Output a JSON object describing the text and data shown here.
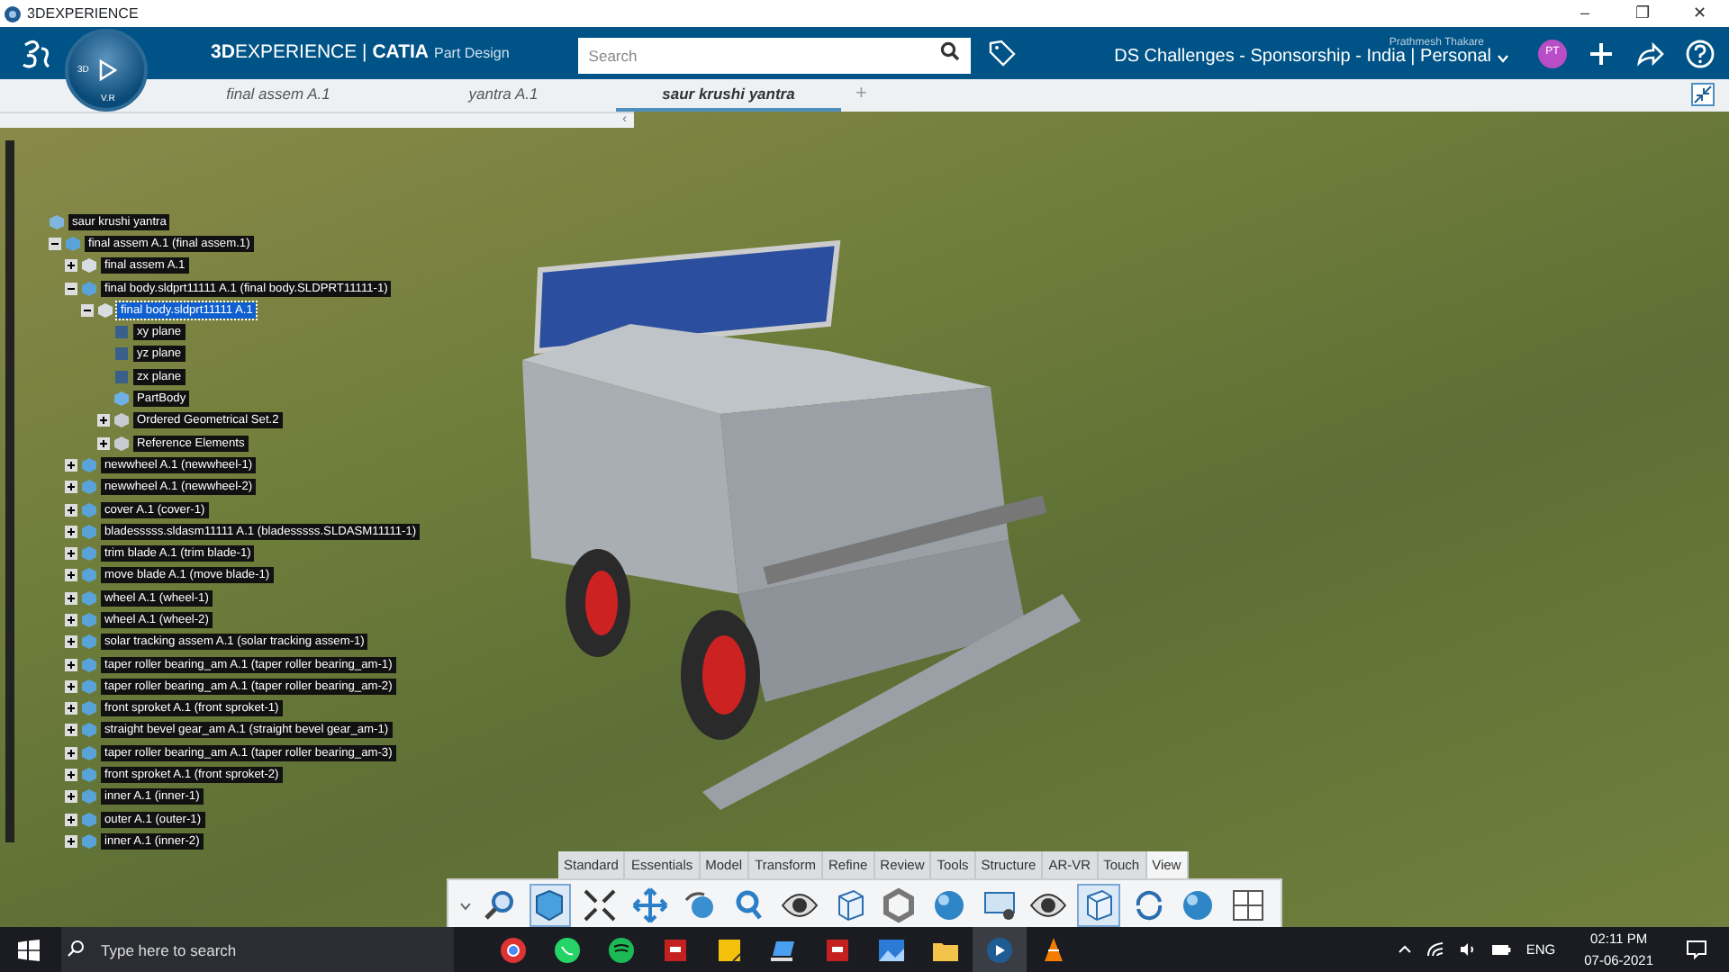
{
  "window": {
    "title": "3DEXPERIENCE",
    "controls": [
      "–",
      "❐",
      "✕"
    ]
  },
  "topbar": {
    "compass_labels": [
      "3D",
      "V.R"
    ],
    "brand": "**3D**EXPERIENCE | **CATIA**",
    "app": "Part Design",
    "search": {
      "placeholder": "Search"
    },
    "user": "Prathmesh Thakare",
    "context": "DS Challenges - Sponsorship - India | Personal",
    "avatar": "PT"
  },
  "tabs": [
    {
      "label": "final assem A.1",
      "selected": false
    },
    {
      "label": "yantra A.1",
      "selected": false
    },
    {
      "label": "saur krushi yantra",
      "selected": true
    }
  ],
  "tabs_add": "+",
  "panel_toggle": "‹",
  "tree": [
    {
      "label": "saur krushi yantra",
      "kind": "root",
      "selected": false,
      "children": [
        {
          "label": "final assem A.1 (final assem.1)",
          "kind": "product",
          "expanded": true,
          "selected": false,
          "children": [
            {
              "label": "final assem A.1",
              "kind": "part",
              "expanded": false,
              "selected": false
            },
            {
              "label": "final body.sldprt11111 A.1 (final body.SLDPRT11111-1)",
              "kind": "product",
              "expanded": true,
              "selected": false,
              "children": [
                {
                  "label": "final body.sldprt11111 A.1",
                  "kind": "part",
                  "expanded": true,
                  "selected": true,
                  "children": [
                    {
                      "label": "xy plane",
                      "kind": "plane",
                      "selected": false
                    },
                    {
                      "label": "yz plane",
                      "kind": "plane",
                      "selected": false
                    },
                    {
                      "label": "zx plane",
                      "kind": "plane",
                      "selected": false
                    },
                    {
                      "label": "PartBody",
                      "kind": "body",
                      "selected": false
                    },
                    {
                      "label": "Ordered Geometrical Set.2",
                      "kind": "set",
                      "expanded": false,
                      "selected": false
                    },
                    {
                      "label": "Reference Elements",
                      "kind": "set",
                      "expanded": false,
                      "selected": false
                    }
                  ]
                }
              ]
            },
            {
              "label": "newwheel A.1 (newwheel-1)",
              "kind": "product",
              "expanded": false,
              "selected": false
            },
            {
              "label": "newwheel A.1 (newwheel-2)",
              "kind": "product",
              "expanded": false,
              "selected": false
            },
            {
              "label": "cover A.1 (cover-1)",
              "kind": "product",
              "expanded": false,
              "selected": false
            },
            {
              "label": "bladesssss.sldasm11111 A.1 (bladesssss.SLDASM11111-1)",
              "kind": "product",
              "expanded": false,
              "selected": false
            },
            {
              "label": "trim blade A.1 (trim blade-1)",
              "kind": "product",
              "expanded": false,
              "selected": false
            },
            {
              "label": "move blade A.1 (move blade-1)",
              "kind": "product",
              "expanded": false,
              "selected": false
            },
            {
              "label": "wheel A.1 (wheel-1)",
              "kind": "product",
              "expanded": false,
              "selected": false
            },
            {
              "label": "wheel A.1 (wheel-2)",
              "kind": "product",
              "expanded": false,
              "selected": false
            },
            {
              "label": "solar tracking assem A.1 (solar tracking assem-1)",
              "kind": "product",
              "expanded": false,
              "selected": false
            },
            {
              "label": "taper roller bearing_am A.1 (taper roller bearing_am-1)",
              "kind": "product",
              "expanded": false,
              "selected": false
            },
            {
              "label": "taper roller bearing_am A.1 (taper roller bearing_am-2)",
              "kind": "product",
              "expanded": false,
              "selected": false
            },
            {
              "label": "front sproket A.1 (front sproket-1)",
              "kind": "product",
              "expanded": false,
              "selected": false
            },
            {
              "label": "straight bevel gear_am A.1 (straight bevel gear_am-1)",
              "kind": "product",
              "expanded": false,
              "selected": false
            },
            {
              "label": "taper roller bearing_am A.1 (taper roller bearing_am-3)",
              "kind": "product",
              "expanded": false,
              "selected": false
            },
            {
              "label": "front sproket A.1 (front sproket-2)",
              "kind": "product",
              "expanded": false,
              "selected": false
            },
            {
              "label": "inner A.1 (inner-1)",
              "kind": "product",
              "expanded": false,
              "selected": false
            },
            {
              "label": "outer A.1 (outer-1)",
              "kind": "product",
              "expanded": false,
              "selected": false
            },
            {
              "label": "inner A.1 (inner-2)",
              "kind": "product",
              "expanded": false,
              "selected": false
            }
          ]
        }
      ]
    }
  ],
  "action_bar": {
    "tabs": [
      {
        "label": "Standard",
        "selected": false
      },
      {
        "label": "Essentials",
        "selected": false
      },
      {
        "label": "Model",
        "selected": false
      },
      {
        "label": "Transform",
        "selected": false
      },
      {
        "label": "Refine",
        "selected": false
      },
      {
        "label": "Review",
        "selected": false
      },
      {
        "label": "Tools",
        "selected": false
      },
      {
        "label": "Structure",
        "selected": false
      },
      {
        "label": "AR-VR",
        "selected": false
      },
      {
        "label": "Touch",
        "selected": false
      },
      {
        "label": "View",
        "selected": true
      }
    ],
    "tools": [
      {
        "kind": "zoom",
        "selected": false
      },
      {
        "kind": "cube",
        "selected": true
      },
      {
        "kind": "fit",
        "selected": false
      },
      {
        "kind": "pan",
        "selected": false
      },
      {
        "kind": "rotate",
        "selected": false
      },
      {
        "kind": "search",
        "selected": false
      },
      {
        "kind": "eye",
        "selected": false
      },
      {
        "kind": "box",
        "selected": false
      },
      {
        "kind": "hex",
        "selected": false
      },
      {
        "kind": "sphere",
        "selected": false
      },
      {
        "kind": "screen",
        "selected": false
      },
      {
        "kind": "eye",
        "selected": false
      },
      {
        "kind": "box",
        "selected": true
      },
      {
        "kind": "cycle",
        "selected": false
      },
      {
        "kind": "sphere",
        "selected": false
      },
      {
        "kind": "grid",
        "selected": false
      }
    ]
  },
  "taskbar": {
    "search": {
      "placeholder": "Type here to search"
    },
    "apps": [
      {
        "kind": "chrome",
        "selected": false
      },
      {
        "kind": "chat",
        "selected": false
      },
      {
        "kind": "music",
        "selected": false
      },
      {
        "kind": "sw",
        "selected": false
      },
      {
        "kind": "note",
        "selected": false
      },
      {
        "kind": "laptop",
        "selected": false
      },
      {
        "kind": "sw",
        "selected": false
      },
      {
        "kind": "photos",
        "selected": false
      },
      {
        "kind": "folder",
        "selected": false
      },
      {
        "kind": "compass",
        "selected": true
      },
      {
        "kind": "cone",
        "selected": false
      }
    ],
    "language": "ENG",
    "time": "02:11 PM",
    "date": "07-06-2021"
  }
}
